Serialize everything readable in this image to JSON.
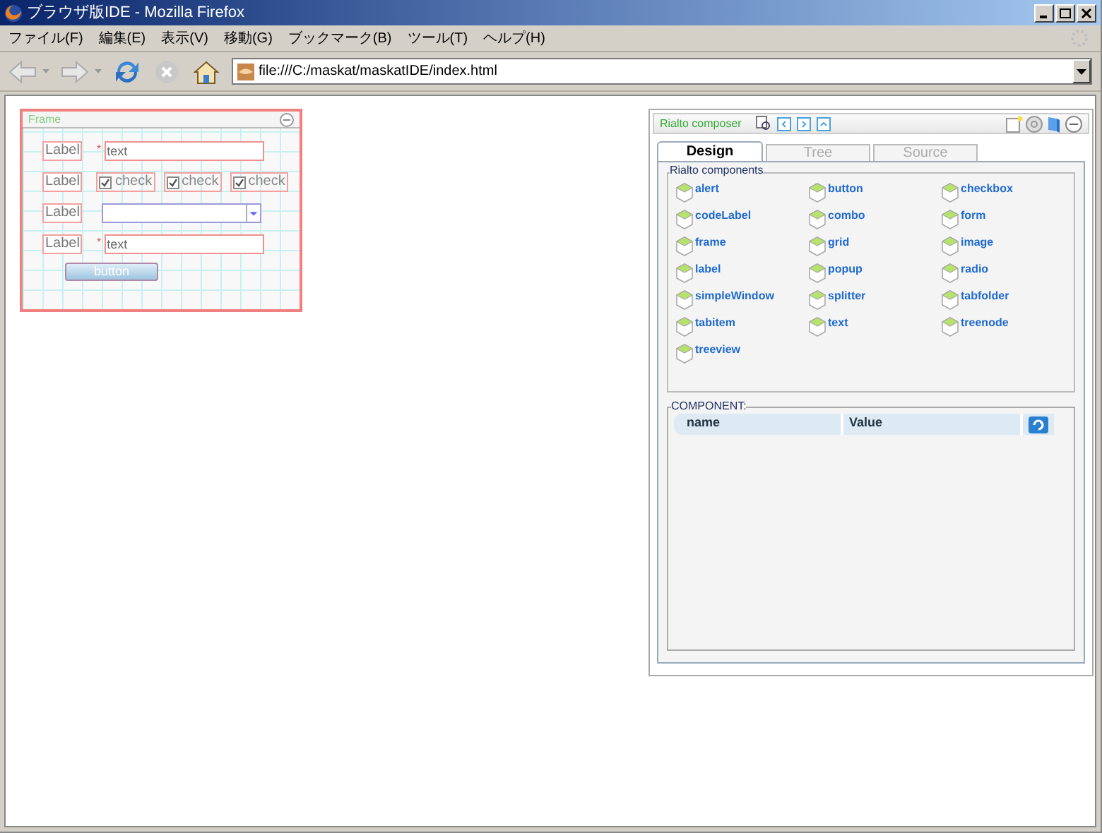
{
  "window": {
    "title": "ブラウザ版IDE - Mozilla Firefox"
  },
  "menu": [
    "ファイル(F)",
    "編集(E)",
    "表示(V)",
    "移動(G)",
    "ブックマーク(B)",
    "ツール(T)",
    "ヘルプ(H)"
  ],
  "address": {
    "value": "file:///C:/maskat/maskatIDE/index.html"
  },
  "frame": {
    "title": "Frame",
    "rows": [
      {
        "kind": "text",
        "label": "Label",
        "mark": "*",
        "value": "text"
      },
      {
        "kind": "checks",
        "label": "Label",
        "checks": [
          {
            "label": "check",
            "checked": true
          },
          {
            "label": "check",
            "checked": true
          },
          {
            "label": "check",
            "checked": true
          }
        ]
      },
      {
        "kind": "combo",
        "label": "Label"
      },
      {
        "kind": "text",
        "label": "Label",
        "mark": "*",
        "value": "text"
      }
    ],
    "button": "button"
  },
  "composer": {
    "title": "Rialto composer",
    "tabs": [
      {
        "label": "Design",
        "selected": true
      },
      {
        "label": "Tree",
        "selected": false
      },
      {
        "label": "Source",
        "selected": false
      }
    ],
    "group_title": "Rialto components",
    "components": [
      "alert",
      "button",
      "checkbox",
      "codeLabel",
      "combo",
      "form",
      "frame",
      "grid",
      "image",
      "label",
      "popup",
      "radio",
      "simpleWindow",
      "splitter",
      "tabfolder",
      "tabitem",
      "text",
      "treenode",
      "treeview"
    ],
    "property_title": "COMPONENT:",
    "columns": [
      "name",
      "Value"
    ]
  }
}
